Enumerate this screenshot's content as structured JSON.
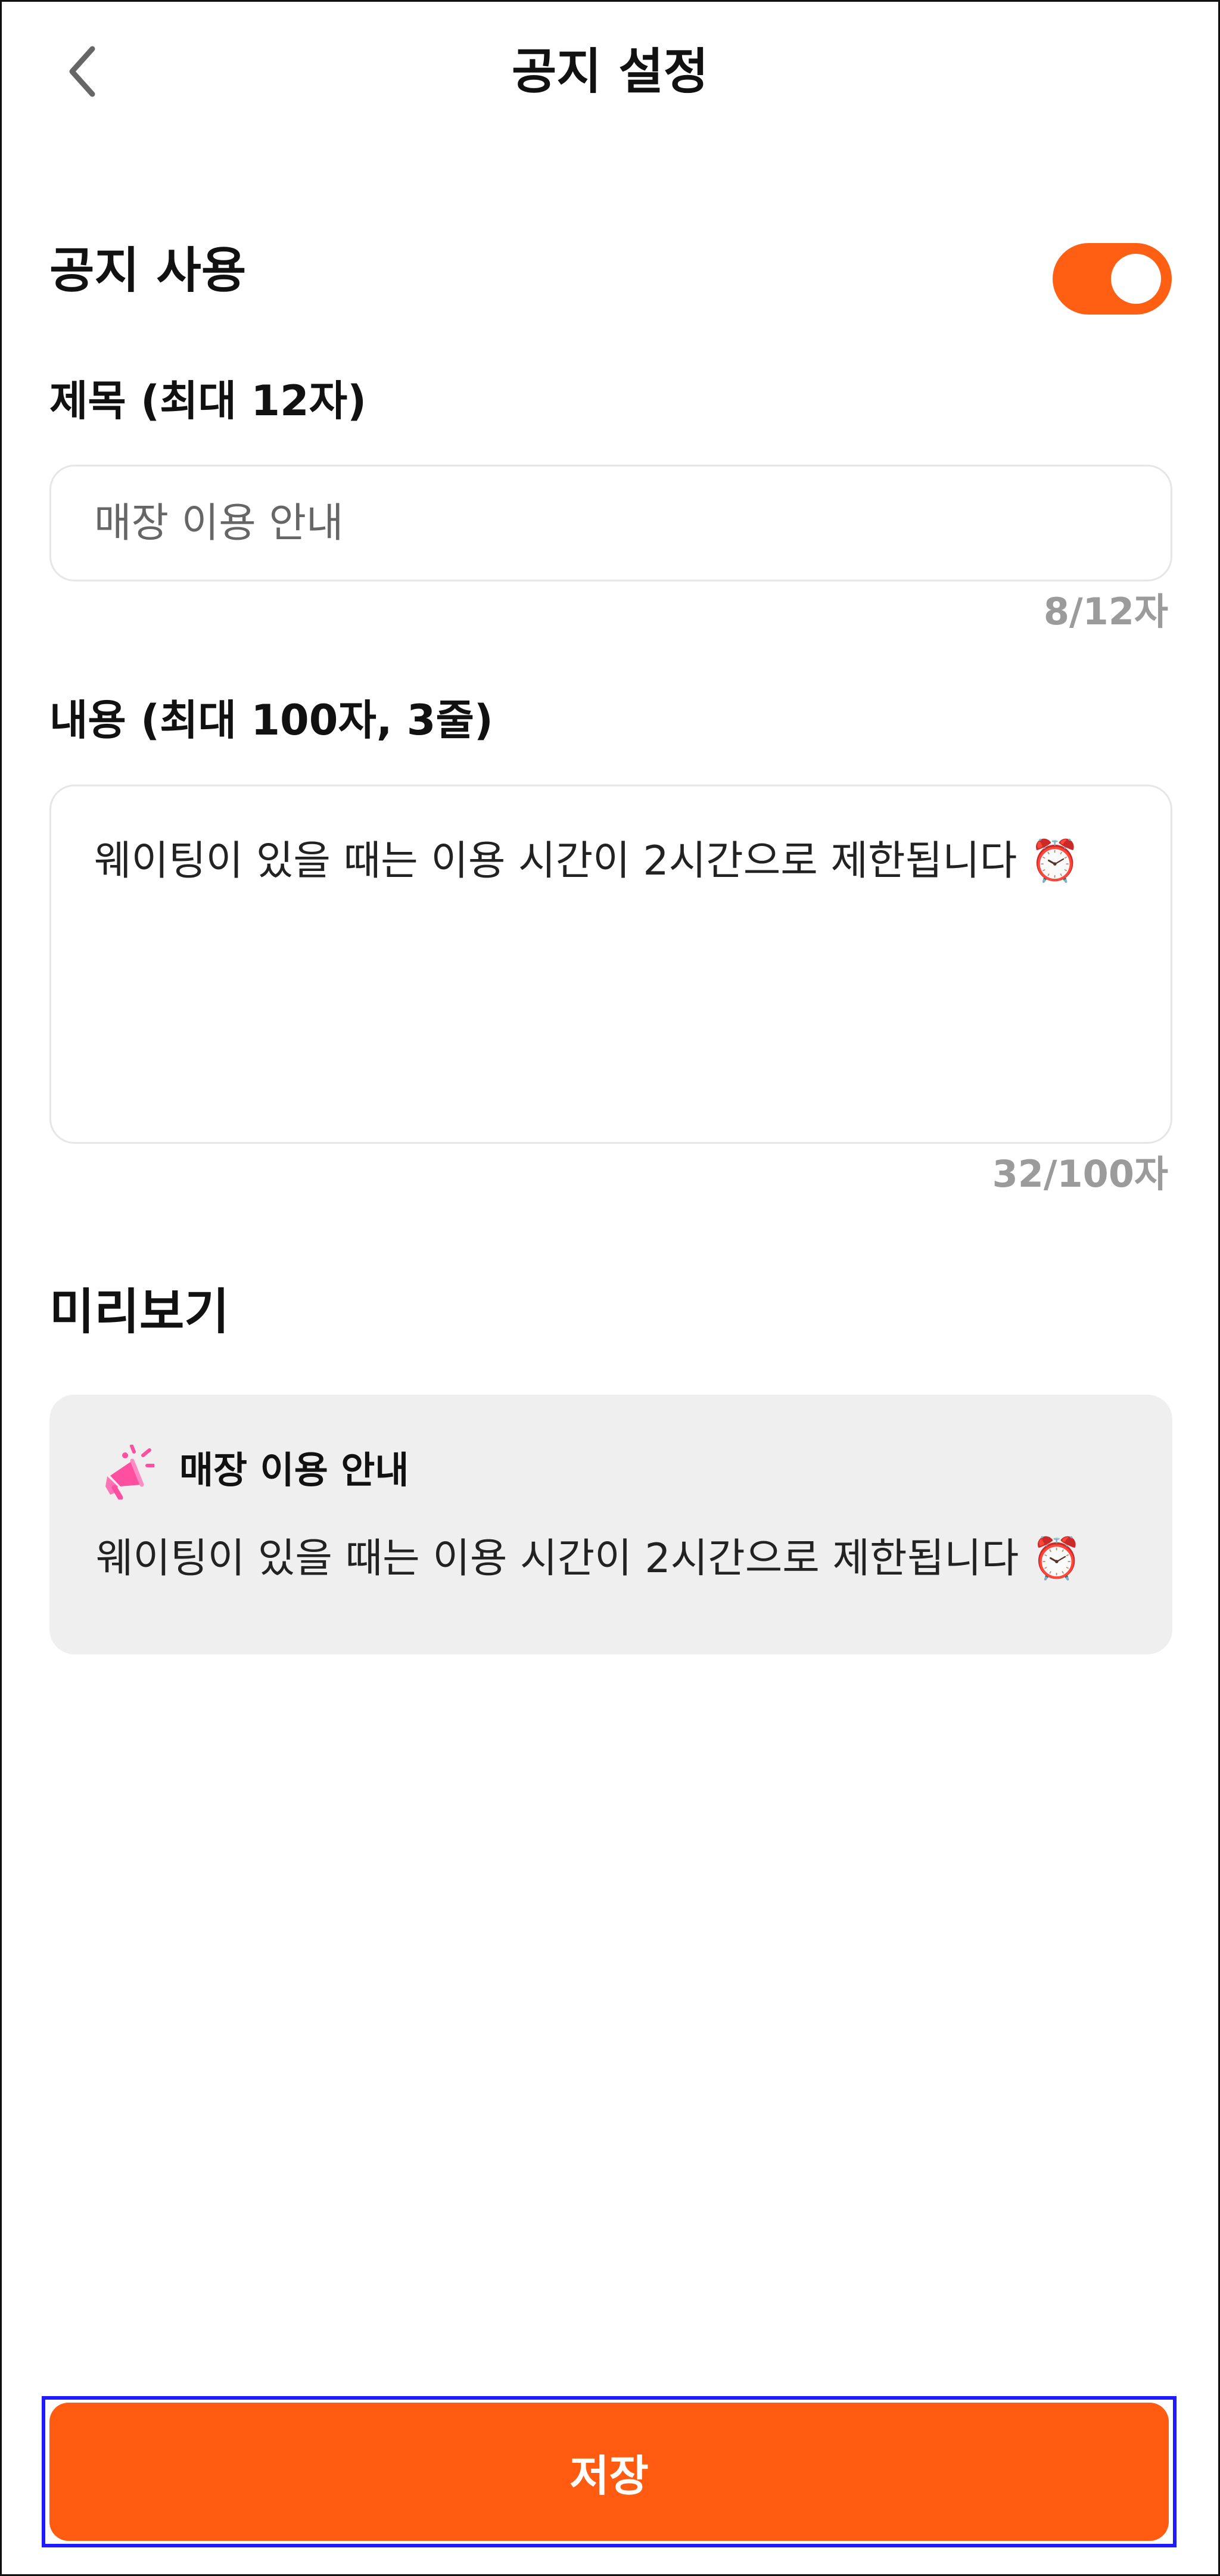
{
  "header": {
    "title": "공지 설정",
    "back_icon": "chevron-left-icon"
  },
  "notice_toggle": {
    "label": "공지 사용",
    "enabled": true,
    "accent_color": "#ff5f12"
  },
  "title_field": {
    "label": "제목 (최대 12자)",
    "value": "",
    "placeholder": "매장 이용 안내",
    "counter": "8/12자"
  },
  "content_field": {
    "label": "내용 (최대 100자, 3줄)",
    "value": "웨이팅이 있을 때는 이용 시간이 2시간으로 제한됩니다 ⏰",
    "counter": "32/100자"
  },
  "preview": {
    "heading": "미리보기",
    "icon": "megaphone-icon",
    "title": "매장 이용 안내",
    "body": "웨이팅이 있을 때는 이용 시간이 2시간으로 제한됩니다 ⏰",
    "background_color": "#efefef"
  },
  "actions": {
    "save_label": "저장",
    "save_color": "#ff5c11",
    "highlight_color": "#1e1bff"
  }
}
